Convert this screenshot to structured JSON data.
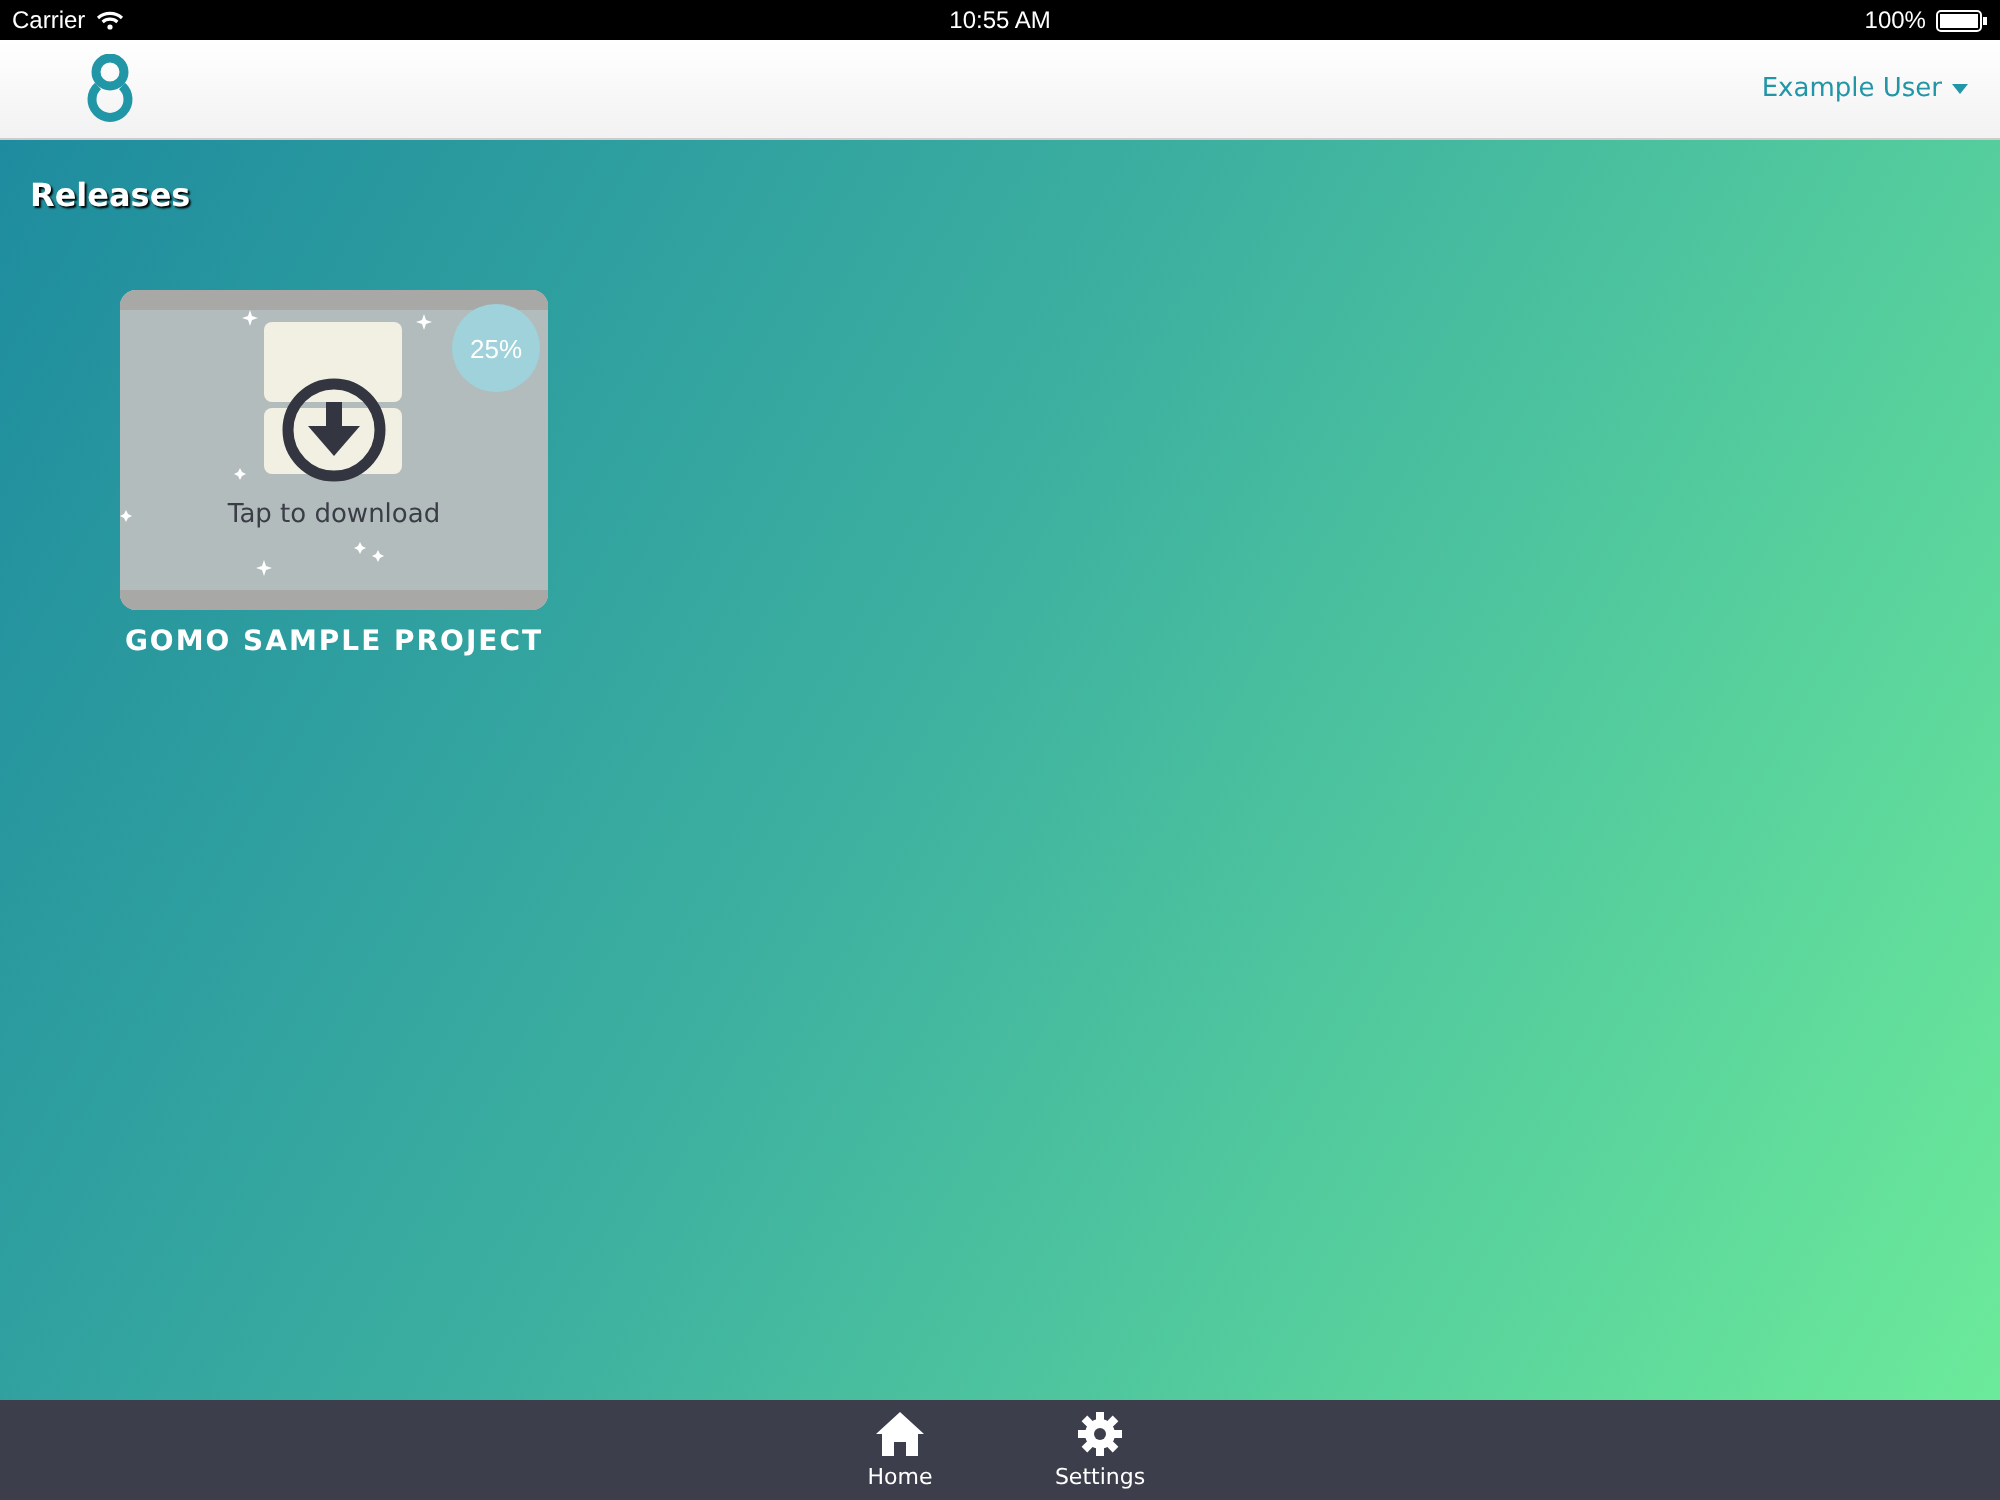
{
  "status_bar": {
    "carrier": "Carrier",
    "time": "10:55 AM",
    "battery": "100%"
  },
  "header": {
    "user_menu": "Example User"
  },
  "section": {
    "title": "Releases"
  },
  "releases": [
    {
      "title": "GOMO SAMPLE PROJECT",
      "progress": "25%",
      "action": "Tap to download"
    }
  ],
  "tab_bar": [
    {
      "label": "Home",
      "kind": "home"
    },
    {
      "label": "Settings",
      "kind": "settings"
    }
  ]
}
